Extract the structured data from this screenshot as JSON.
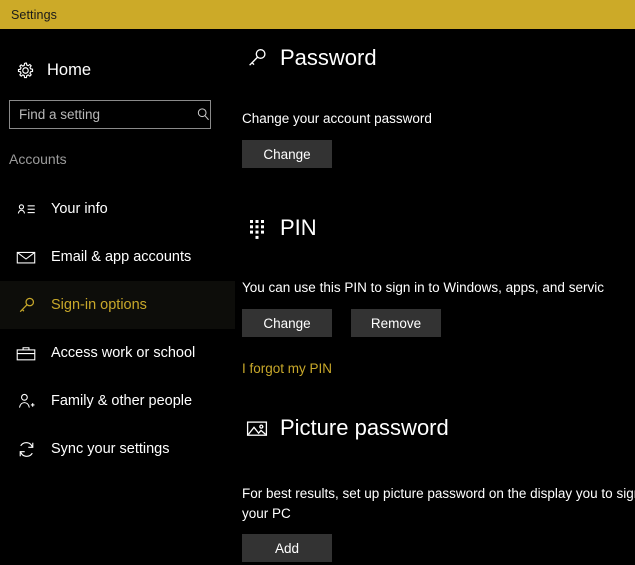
{
  "window": {
    "title": "Settings",
    "titlebar_color": "#ccaa28",
    "background_color": "#000000",
    "accent_color": "#c8a82a"
  },
  "sidebar": {
    "home": {
      "label": "Home",
      "icon": "gear-icon"
    },
    "search": {
      "value": "",
      "placeholder": "Find a setting",
      "icon": "search-icon"
    },
    "group_label": "Accounts",
    "items": [
      {
        "label": "Your info",
        "icon": "contact-card-icon",
        "selected": false
      },
      {
        "label": "Email & app accounts",
        "icon": "mail-icon",
        "selected": false
      },
      {
        "label": "Sign-in options",
        "icon": "key-icon",
        "selected": true
      },
      {
        "label": "Access work or school",
        "icon": "briefcase-icon",
        "selected": false
      },
      {
        "label": "Family & other people",
        "icon": "add-person-icon",
        "selected": false
      },
      {
        "label": "Sync your settings",
        "icon": "sync-icon",
        "selected": false
      }
    ]
  },
  "main": {
    "sections": [
      {
        "heading": "Password",
        "icon": "key-icon",
        "description": "Change your account password",
        "buttons": [
          {
            "label": "Change"
          }
        ],
        "link": null
      },
      {
        "heading": "PIN",
        "icon": "keypad-icon",
        "description": "You can use this PIN to sign in to Windows, apps, and servic",
        "buttons": [
          {
            "label": "Change"
          },
          {
            "label": "Remove"
          }
        ],
        "link": "I forgot my PIN"
      },
      {
        "heading": "Picture password",
        "icon": "picture-icon",
        "description": "For best results, set up picture password on the display you to sign in to  your PC",
        "buttons": [
          {
            "label": "Add"
          }
        ],
        "link": null
      }
    ]
  }
}
